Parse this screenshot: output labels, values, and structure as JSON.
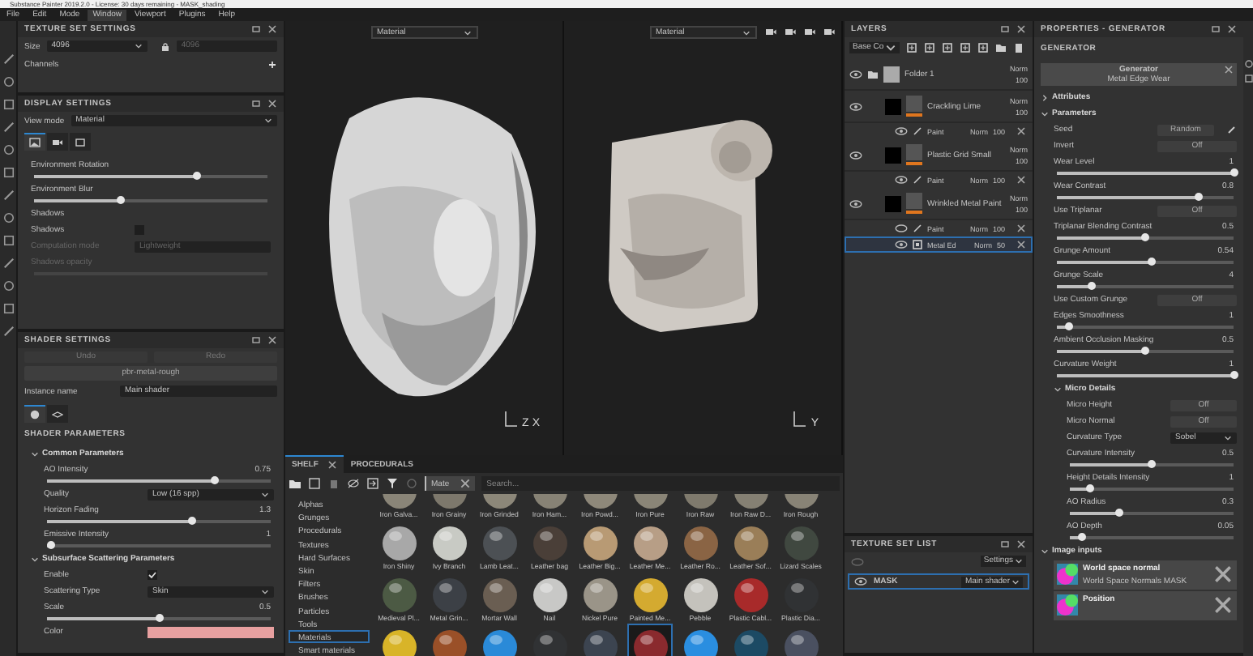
{
  "title_bar": {
    "title": "Substance Painter 2019.2.0 - License: 30 days remaining - MASK_shading"
  },
  "menu": [
    {
      "label": "File",
      "selected": false
    },
    {
      "label": "Edit",
      "selected": false
    },
    {
      "label": "Mode",
      "selected": false
    },
    {
      "label": "Window",
      "selected": true
    },
    {
      "label": "Viewport",
      "selected": false
    },
    {
      "label": "Plugins",
      "selected": false
    },
    {
      "label": "Help",
      "selected": false
    }
  ],
  "texture_set_settings": {
    "title": "TEXTURE SET SETTINGS",
    "size_label": "Size",
    "size": "4096",
    "size_linked": "4096",
    "channels_label": "Channels"
  },
  "display_settings": {
    "title": "DISPLAY SETTINGS",
    "view_mode_label": "View mode",
    "view_mode": "Material",
    "tabs": [
      {
        "selected": true
      },
      {
        "selected": false
      },
      {
        "selected": false
      }
    ],
    "rows": [
      {
        "kind": "slider",
        "label": "Environment Rotation",
        "level": 0.7,
        "disabled": false
      },
      {
        "kind": "slider",
        "label": "Environment Blur",
        "level": 0.37,
        "disabled": false
      },
      {
        "kind": "section",
        "label": "Shadows"
      },
      {
        "kind": "check",
        "label": "Shadows",
        "checked": false
      },
      {
        "kind": "select",
        "label": "Computation mode",
        "value": "Lightweight",
        "disabled": true
      },
      {
        "kind": "slider",
        "label": "Shadows opacity",
        "disabled": true
      }
    ]
  },
  "shader_settings": {
    "title": "SHADER SETTINGS",
    "undo": "Undo",
    "redo": "Redo",
    "shader": "pbr-metal-rough",
    "instance_label": "Instance name",
    "instance": "Main shader",
    "tabs": [
      {
        "selected": true
      },
      {
        "selected": false
      }
    ],
    "parameters_title": "SHADER PARAMETERS",
    "rows": [
      {
        "kind": "group",
        "label": "Common Parameters",
        "expanded": true,
        "rows": [
          {
            "kind": "slider",
            "label": "AO Intensity",
            "value": "0.75",
            "level": 0.75,
            "disabled": false
          },
          {
            "kind": "select",
            "label": "Quality",
            "value": "Low (16 spp)",
            "disabled": false
          },
          {
            "kind": "slider",
            "label": "Horizon Fading",
            "value": "1.3",
            "level": 0.65,
            "disabled": false
          },
          {
            "kind": "slider",
            "label": "Emissive Intensity",
            "value": "1",
            "level": 0.02,
            "disabled": false
          }
        ]
      },
      {
        "kind": "group",
        "label": "Subsurface Scattering Parameters",
        "expanded": true,
        "rows": [
          {
            "kind": "check",
            "label": "Enable",
            "checked": true
          },
          {
            "kind": "select",
            "label": "Scattering Type",
            "value": "Skin",
            "disabled": false
          },
          {
            "kind": "slider",
            "label": "Scale",
            "value": "0.5",
            "level": 0.5,
            "disabled": false
          },
          {
            "kind": "swatch",
            "label": "Color",
            "color": "#e8a0a0"
          }
        ]
      }
    ]
  },
  "viewport": {
    "views": [
      {
        "mode": "Material",
        "axes": [
          "Z",
          "X"
        ]
      },
      {
        "mode": "Material",
        "axes": [
          "Y"
        ]
      }
    ]
  },
  "shelf": {
    "tabs": [
      {
        "label": "SHELF",
        "selected": true
      },
      {
        "label": "PROCEDURALS",
        "selected": false
      }
    ],
    "filter": "Mate",
    "search_placeholder": "Search...",
    "categories": [
      {
        "label": "Alphas",
        "selected": false
      },
      {
        "label": "Grunges",
        "selected": false
      },
      {
        "label": "Procedurals",
        "selected": false
      },
      {
        "label": "Textures",
        "selected": false
      },
      {
        "label": "Hard Surfaces",
        "selected": false
      },
      {
        "label": "Skin",
        "selected": false
      },
      {
        "label": "Filters",
        "selected": false
      },
      {
        "label": "Brushes",
        "selected": false
      },
      {
        "label": "Particles",
        "selected": false
      },
      {
        "label": "Tools",
        "selected": false
      },
      {
        "label": "Materials",
        "selected": true
      },
      {
        "label": "Smart materials",
        "selected": false
      }
    ],
    "materials": [
      {
        "name": "Iron Galva...",
        "color": "#8a8578",
        "selected": false
      },
      {
        "name": "Iron Grainy",
        "color": "#7d786c",
        "selected": false
      },
      {
        "name": "Iron Grinded",
        "color": "#8c8779",
        "selected": false
      },
      {
        "name": "Iron Ham...",
        "color": "#878275",
        "selected": false
      },
      {
        "name": "Iron Powd...",
        "color": "#8e887a",
        "selected": false
      },
      {
        "name": "Iron Pure",
        "color": "#8a8577",
        "selected": false
      },
      {
        "name": "Iron Raw",
        "color": "#7f7a6d",
        "selected": false
      },
      {
        "name": "Iron Raw D...",
        "color": "#858073",
        "selected": false
      },
      {
        "name": "Iron Rough",
        "color": "#888376",
        "selected": false
      },
      {
        "name": "Iron Shiny",
        "color": "#a8a8a8",
        "selected": false
      },
      {
        "name": "Ivy Branch",
        "color": "#c8cac4",
        "selected": false
      },
      {
        "name": "Lamb Leat...",
        "color": "#4c5054",
        "selected": false
      },
      {
        "name": "Leather bag",
        "color": "#4a3f38",
        "selected": false
      },
      {
        "name": "Leather Big...",
        "color": "#b89a74",
        "selected": false
      },
      {
        "name": "Leather Me...",
        "color": "#b79e86",
        "selected": false
      },
      {
        "name": "Leather Ro...",
        "color": "#8a6444",
        "selected": false
      },
      {
        "name": "Leather Sof...",
        "color": "#9a7e58",
        "selected": false
      },
      {
        "name": "Lizard Scales",
        "color": "#404840",
        "selected": false
      },
      {
        "name": "Medieval Pl...",
        "color": "#4c5a44",
        "selected": false
      },
      {
        "name": "Metal Grin...",
        "color": "#3c4046",
        "selected": false
      },
      {
        "name": "Mortar Wall",
        "color": "#6a5e52",
        "selected": false
      },
      {
        "name": "Nail",
        "color": "#c8c8c6",
        "selected": false
      },
      {
        "name": "Nickel Pure",
        "color": "#9a9488",
        "selected": false
      },
      {
        "name": "Painted Me...",
        "color": "#d4aa30",
        "selected": false
      },
      {
        "name": "Pebble",
        "color": "#c4c2bc",
        "selected": false
      },
      {
        "name": "Plastic Cabl...",
        "color": "#a82a2a",
        "selected": false
      },
      {
        "name": "Plastic Dia...",
        "color": "#303234",
        "selected": false
      },
      {
        "color": "#d8b428",
        "selected": false
      },
      {
        "color": "#9a5028",
        "selected": false
      },
      {
        "color": "#2a8ad8",
        "selected": false
      },
      {
        "color": "#303234",
        "selected": false
      },
      {
        "color": "#3c4450",
        "selected": false
      },
      {
        "color": "#8a2a2e",
        "selected": true
      },
      {
        "color": "#2a8ee0",
        "selected": false
      },
      {
        "color": "#1c4a64",
        "selected": false
      },
      {
        "color": "#4a5060",
        "selected": false
      }
    ]
  },
  "layers": {
    "title": "LAYERS",
    "channel": "Base Co",
    "items": [
      {
        "kind": "folder",
        "name": "Folder 1",
        "blend": "Norm",
        "opacity": "100",
        "visible": true,
        "selected": false
      },
      {
        "kind": "fill",
        "name": "Crackling Lime",
        "blend": "Norm",
        "opacity": "100",
        "visible": true,
        "selected": false,
        "effects": [
          {
            "kind": "paint",
            "name": "Paint",
            "blend": "Norm",
            "opacity": "100",
            "visible": true,
            "selected": false
          }
        ]
      },
      {
        "kind": "fill",
        "name": "Plastic Grid Small",
        "blend": "Norm",
        "opacity": "100",
        "visible": true,
        "selected": false,
        "effects": [
          {
            "kind": "paint",
            "name": "Paint",
            "blend": "Norm",
            "opacity": "100",
            "visible": true,
            "selected": false
          }
        ]
      },
      {
        "kind": "fill",
        "name": "Wrinkled Metal Paint",
        "blend": "Norm",
        "opacity": "100",
        "visible": true,
        "selected": false,
        "effects": [
          {
            "kind": "paint",
            "name": "Paint",
            "blend": "Norm",
            "opacity": "100",
            "visible": false,
            "selected": false
          },
          {
            "kind": "generator",
            "name": "Metal Ed",
            "blend": "Norm",
            "opacity": "50",
            "visible": true,
            "selected": true
          }
        ]
      }
    ]
  },
  "texture_set_list": {
    "title": "TEXTURE SET LIST",
    "settings": "Settings",
    "sets": [
      {
        "name": "MASK",
        "shader": "Main shader",
        "selected": true,
        "visible": true
      }
    ]
  },
  "properties": {
    "title": "PROPERTIES - GENERATOR",
    "section": "GENERATOR",
    "card_title": "Generator",
    "card_value": "Metal Edge Wear",
    "rows": [
      {
        "kind": "group",
        "label": "Attributes",
        "expanded": false
      },
      {
        "kind": "group",
        "label": "Parameters",
        "expanded": true,
        "rows": [
          {
            "kind": "seed",
            "label": "Seed",
            "value": "Random"
          },
          {
            "kind": "toggle",
            "label": "Invert",
            "value": "Off"
          },
          {
            "kind": "slider",
            "label": "Wear Level",
            "value": "1",
            "level": 1,
            "disabled": false
          },
          {
            "kind": "slider",
            "label": "Wear Contrast",
            "value": "0.8",
            "level": 0.8,
            "disabled": false
          },
          {
            "kind": "toggle",
            "label": "Use Triplanar",
            "value": "Off"
          },
          {
            "kind": "slider",
            "label": "Triplanar Blending Contrast",
            "value": "0.5",
            "level": 0.5,
            "disabled": false
          },
          {
            "kind": "slider",
            "label": "Grunge Amount",
            "value": "0.54",
            "level": 0.54,
            "disabled": false
          },
          {
            "kind": "slider",
            "label": "Grunge Scale",
            "value": "4",
            "level": 0.2,
            "disabled": false
          },
          {
            "kind": "toggle",
            "label": "Use Custom Grunge",
            "value": "Off"
          },
          {
            "kind": "slider",
            "label": "Edges Smoothness",
            "value": "1",
            "level": 0.07,
            "disabled": false
          },
          {
            "kind": "slider",
            "label": "Ambient Occlusion Masking",
            "value": "0.5",
            "level": 0.5,
            "disabled": false
          },
          {
            "kind": "slider",
            "label": "Curvature Weight",
            "value": "1",
            "level": 1,
            "disabled": false
          },
          {
            "kind": "group",
            "label": "Micro Details",
            "expanded": true,
            "rows": [
              {
                "kind": "toggle",
                "label": "Micro Height",
                "value": "Off"
              },
              {
                "kind": "toggle",
                "label": "Micro Normal",
                "value": "Off"
              },
              {
                "kind": "select",
                "label": "Curvature Type",
                "value": "Sobel",
                "disabled": false
              },
              {
                "kind": "slider",
                "label": "Curvature Intensity",
                "value": "0.5",
                "level": 0.5,
                "disabled": false
              },
              {
                "kind": "slider",
                "label": "Height Details Intensity",
                "value": "1",
                "level": 0.12,
                "disabled": false
              },
              {
                "kind": "slider",
                "label": "AO Radius",
                "value": "0.3",
                "level": 0.3,
                "disabled": false
              },
              {
                "kind": "slider",
                "label": "AO Depth",
                "value": "0.05",
                "level": 0.07,
                "disabled": false
              }
            ]
          }
        ]
      },
      {
        "kind": "group",
        "label": "Image inputs",
        "expanded": true,
        "rows": [
          {
            "kind": "input",
            "title": "World space normal",
            "subtitle": "World Space Normals MASK"
          },
          {
            "kind": "input",
            "title": "Position"
          }
        ]
      }
    ]
  }
}
